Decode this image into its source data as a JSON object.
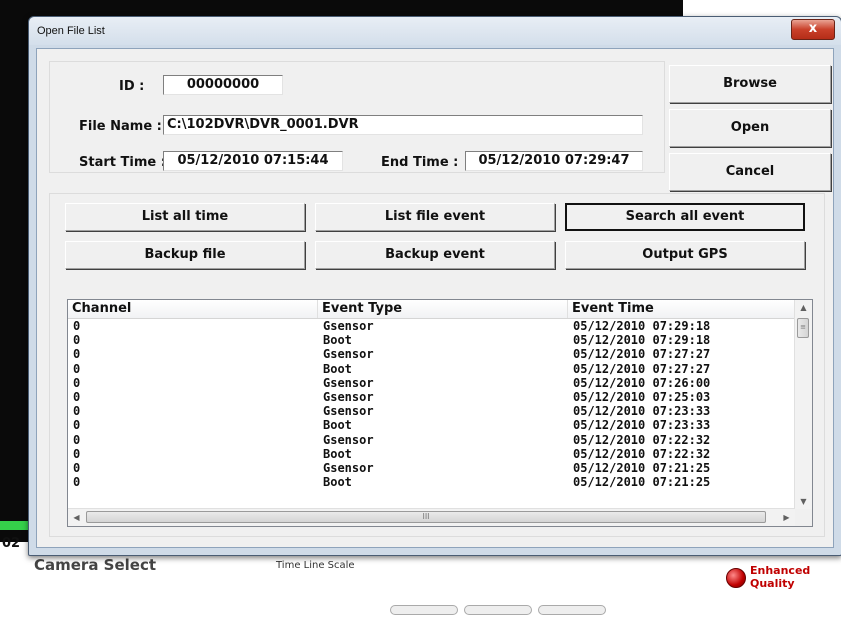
{
  "background": {
    "timecode": "02",
    "camera_select": "Camera Select",
    "timeline_scale": "Time Line Scale",
    "enhanced_quality": "Enhanced Quality",
    "accent_green": "#35d04a",
    "accent_red": "#c00000"
  },
  "dialog": {
    "title": "Open File List",
    "close_glyph": "x"
  },
  "info": {
    "id_label": "ID :",
    "id_value": "00000000",
    "file_name_label": "File Name :",
    "file_name_value": "C:\\102DVR\\DVR_0001.DVR",
    "start_time_label": "Start Time :",
    "start_time_value": "05/12/2010 07:15:44",
    "end_time_label": "End Time :",
    "end_time_value": "05/12/2010 07:29:47"
  },
  "side_buttons": {
    "browse": "Browse",
    "open": "Open",
    "cancel": "Cancel"
  },
  "action_buttons": {
    "list_all_time": "List all time",
    "list_file_event": "List file event",
    "search_all_event": "Search all event",
    "backup_file": "Backup file",
    "backup_event": "Backup event",
    "output_gps": "Output GPS"
  },
  "list": {
    "columns": [
      "Channel",
      "Event Type",
      "Event Time"
    ],
    "rows": [
      [
        "0",
        "Gsensor",
        "05/12/2010 07:29:18"
      ],
      [
        "0",
        "Boot",
        "05/12/2010 07:29:18"
      ],
      [
        "0",
        "Gsensor",
        "05/12/2010 07:27:27"
      ],
      [
        "0",
        "Boot",
        "05/12/2010 07:27:27"
      ],
      [
        "0",
        "Gsensor",
        "05/12/2010 07:26:00"
      ],
      [
        "0",
        "Gsensor",
        "05/12/2010 07:25:03"
      ],
      [
        "0",
        "Gsensor",
        "05/12/2010 07:23:33"
      ],
      [
        "0",
        "Boot",
        "05/12/2010 07:23:33"
      ],
      [
        "0",
        "Gsensor",
        "05/12/2010 07:22:32"
      ],
      [
        "0",
        "Boot",
        "05/12/2010 07:22:32"
      ],
      [
        "0",
        "Gsensor",
        "05/12/2010 07:21:25"
      ],
      [
        "0",
        "Boot",
        "05/12/2010 07:21:25"
      ]
    ],
    "scroll_up_glyph": "▲",
    "scroll_down_glyph": "▼",
    "scroll_left_glyph": "◀",
    "scroll_right_glyph": "▶",
    "vthumb_grip": "≡",
    "hthumb_grip": "III"
  }
}
